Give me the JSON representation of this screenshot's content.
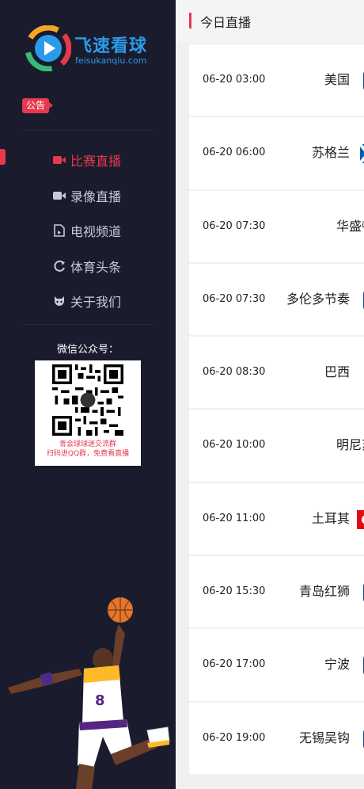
{
  "brand": {
    "name": "飞速看球",
    "domain": "feisukanqiu.com"
  },
  "notice": {
    "label": "公告"
  },
  "nav": [
    {
      "label": "比赛直播",
      "icon": "video-camera-icon",
      "active": true
    },
    {
      "label": "录像直播",
      "icon": "video-camera-icon",
      "active": false
    },
    {
      "label": "电视频道",
      "icon": "tv-document-icon",
      "active": false
    },
    {
      "label": "体育头条",
      "icon": "refresh-icon",
      "active": false
    },
    {
      "label": "关于我们",
      "icon": "github-icon",
      "active": false
    }
  ],
  "wechat": {
    "label": "微信公众号：",
    "caption_line1": "青会球球迷交流群",
    "caption_line2": "扫码进QQ群，免费看直播"
  },
  "main": {
    "title": "今日直播"
  },
  "matches": [
    {
      "time": "06-20 03:00",
      "team": "美国",
      "logo": "nba-logo-icon"
    },
    {
      "time": "06-20 06:00",
      "team": "苏格兰",
      "logo": "scotland-flag-icon"
    },
    {
      "time": "06-20 07:30",
      "team": "华盛顿神",
      "logo": "none"
    },
    {
      "time": "06-20 07:30",
      "team": "多伦多节奏",
      "logo": "nba-logo-icon"
    },
    {
      "time": "06-20 08:30",
      "team": "巴西",
      "logo": "trophy-icon"
    },
    {
      "time": "06-20 10:00",
      "team": "明尼苏达",
      "logo": "none"
    },
    {
      "time": "06-20 11:00",
      "team": "土耳其",
      "logo": "turkey-flag-icon"
    },
    {
      "time": "06-20 15:30",
      "team": "青岛红狮",
      "logo": "nba-logo-icon"
    },
    {
      "time": "06-20 17:00",
      "team": "宁波",
      "logo": "nba-logo-icon"
    },
    {
      "time": "06-20 19:00",
      "team": "无锡吴钩",
      "logo": "nba-logo-icon"
    }
  ]
}
